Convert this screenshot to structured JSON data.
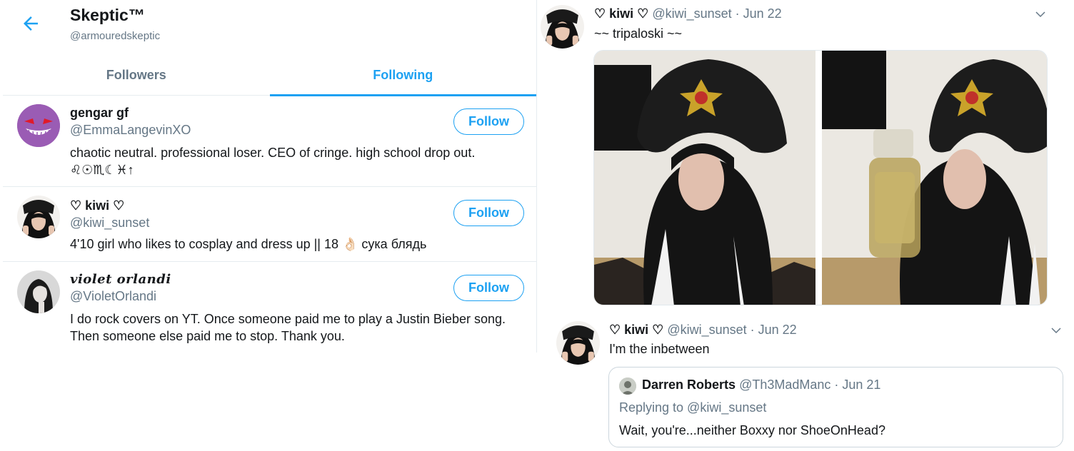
{
  "profile": {
    "name": "Skeptic™",
    "handle": "@armouredskeptic"
  },
  "tabs": [
    {
      "label": "Followers",
      "active": false
    },
    {
      "label": "Following",
      "active": true
    }
  ],
  "following": [
    {
      "name": "gengar gf",
      "handle": "@EmmaLangevinXO",
      "bio_line1": "chaotic neutral. professional loser. CEO of cringe. high school drop out.",
      "bio_line2": "♌︎☉♏︎☾♓︎↑",
      "button": "Follow"
    },
    {
      "name": "♡ kiwi ♡",
      "handle": "@kiwi_sunset",
      "bio_line1": "4'10 girl who likes to cosplay and dress up || 18 👌🏻 сука блядь",
      "button": "Follow"
    },
    {
      "name": "violet orlandi",
      "handle": "@VioletOrlandi",
      "bio_line1": "I do rock covers on YT. Once someone paid me to play a Justin Bieber song.",
      "bio_line2": "Then someone else paid me to stop. Thank you.",
      "button": "Follow"
    }
  ],
  "tweet1": {
    "name": "♡ kiwi ♡",
    "meta": "@kiwi_sunset · Jun 22",
    "text": "~~ tripaloski ~~"
  },
  "tweet2": {
    "name": "♡ kiwi ♡",
    "meta": "@kiwi_sunset · Jun 22",
    "text": "I'm the inbetween"
  },
  "quoted": {
    "name": "Darren Roberts",
    "meta": "@Th3MadManc · Jun 21",
    "reply": "Replying to @kiwi_sunset",
    "text": "Wait, you're...neither Boxxy nor ShoeOnHead?"
  },
  "colors": {
    "accent": "#1da1f2",
    "secondary_text": "#657786",
    "primary_text": "#14171a",
    "divider": "#e6ecf0",
    "gengar_purple": "#9a5cb4"
  },
  "icons": {
    "back": "back-arrow-icon",
    "caret": "chevron-down-icon"
  }
}
